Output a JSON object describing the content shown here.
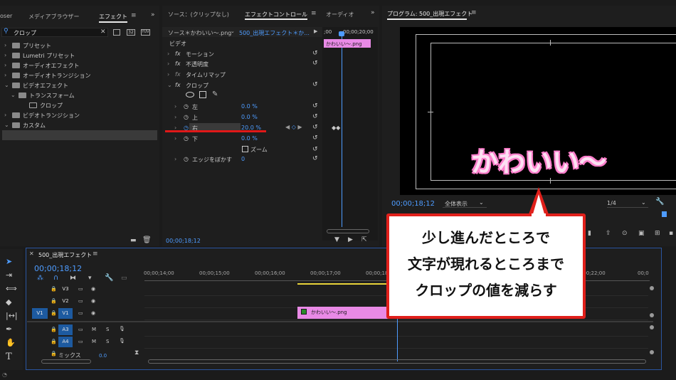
{
  "effects_panel": {
    "tabs": [
      "oser",
      "メディアブラウザー",
      "エフェクト",
      "≡"
    ],
    "active_tab": "エフェクト",
    "search_value": "クロップ",
    "tree": [
      {
        "label": "プリセット",
        "level": 0
      },
      {
        "label": "Lumetri プリセット",
        "level": 0
      },
      {
        "label": "オーディオエフェクト",
        "level": 0
      },
      {
        "label": "オーディオトランジション",
        "level": 0
      },
      {
        "label": "ビデオエフェクト",
        "level": 0
      },
      {
        "label": "トランスフォーム",
        "level": 1
      },
      {
        "label": "クロップ",
        "level": 2
      },
      {
        "label": "ビデオトランジション",
        "level": 0
      },
      {
        "label": "カスタム",
        "level": 0
      },
      {
        "label": "クロップ",
        "level": 1
      }
    ]
  },
  "effect_controls": {
    "tabs": [
      "ソース：(クリップなし)",
      "エフェクトコントロール",
      "≡",
      "オーディオ"
    ],
    "source_label": "ソース＊かわいい～.png",
    "sequence_label": "500_出現エフェクト＊か...",
    "ruler_times": [
      ";00",
      "00;00;20;00"
    ],
    "clip_label": "かわいい～.png",
    "section": "ビデオ",
    "effects": [
      "モーション",
      "不透明度",
      "タイムリマップ",
      "クロップ"
    ],
    "params": [
      {
        "name": "左",
        "value": "0.0 %"
      },
      {
        "name": "上",
        "value": "0.0 %"
      },
      {
        "name": "右",
        "value": "20.0 %"
      },
      {
        "name": "下",
        "value": "0.0 %"
      }
    ],
    "zoom_label": "ズーム",
    "feather_label": "エッジをぼかす",
    "feather_value": "0",
    "timecode": "00;00;18;12"
  },
  "program": {
    "title": "プログラム: 500_出現エフェクト",
    "menu_icon": "≡",
    "overlay_text": "かわいい〜",
    "timecode": "00;00;18;12",
    "fit_label": "全体表示",
    "resolution": "1/4"
  },
  "timeline": {
    "sequence_name": "500_出現エフェクト",
    "menu_icon": "≡",
    "timecode": "00;00;18;12",
    "ruler": [
      "00;00;14;00",
      "00;00;15;00",
      "00;00;16;00",
      "00;00;17;00",
      "00;00;18;0",
      "00;00;22;00",
      "00;0"
    ],
    "tracks": [
      {
        "name": "V3",
        "source": ""
      },
      {
        "name": "V2",
        "source": ""
      },
      {
        "name": "V1",
        "source": "V1"
      },
      {
        "name": "A3",
        "source": ""
      },
      {
        "name": "A4",
        "source": ""
      }
    ],
    "mix_label": "ミックス",
    "mix_value": "0.0",
    "clip_label": "かわいい～.png",
    "mute": "M",
    "solo": "S"
  },
  "callout": {
    "lines": [
      "少し進んだところで",
      "文字が現れるところまで",
      "クロップの値を減らす"
    ],
    "color": "#e0201b"
  },
  "colors": {
    "accent": "#4e9cff",
    "clip": "#e98ae6",
    "highlight": "#e01818"
  }
}
